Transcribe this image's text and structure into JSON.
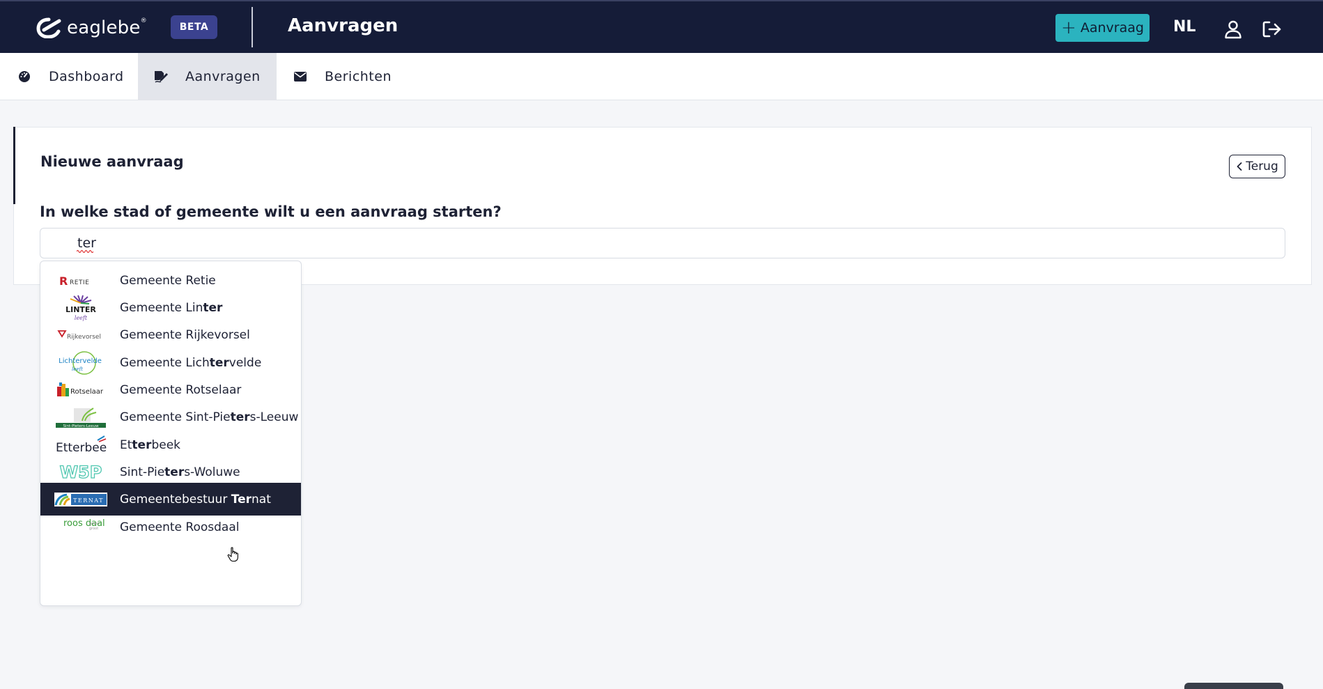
{
  "topbar": {
    "brand": "eaglebe",
    "brand_mark": "®",
    "badge": "BETA",
    "title": "Aanvragen",
    "new_button": "Aanvraag",
    "language": "NL"
  },
  "tabs": [
    {
      "label": "Dashboard",
      "icon": "dashboard-gauge-icon"
    },
    {
      "label": "Aanvragen",
      "icon": "edit-signature-icon",
      "active": true
    },
    {
      "label": "Berichten",
      "icon": "envelope-icon"
    }
  ],
  "card": {
    "title": "Nieuwe aanvraag",
    "back_button": "Terug",
    "question": "In welke stad of gemeente wilt u een aanvraag starten?",
    "search_value": "ter"
  },
  "dropdown": {
    "options": [
      {
        "pre": "Gemeente Retie",
        "hl": "",
        "post": "",
        "logo_text": "RETIE"
      },
      {
        "pre": "Gemeente Lin",
        "hl": "ter",
        "post": "",
        "logo_text": "LINTER"
      },
      {
        "pre": "Gemeente Rijkevorsel",
        "hl": "",
        "post": "",
        "logo_text": "Rijkevorsel"
      },
      {
        "pre": "Gemeente Lich",
        "hl": "ter",
        "post": "velde",
        "logo_text": "Lichtervelde"
      },
      {
        "pre": "Gemeente Rotselaar",
        "hl": "",
        "post": "",
        "logo_text": "Rotselaar"
      },
      {
        "pre": "Gemeente Sint-Pie",
        "hl": "ter",
        "post": "s-Leeuw",
        "logo_text": "Sint-Pieters-Leeuw"
      },
      {
        "pre": "Et",
        "hl": "ter",
        "post": "beek",
        "logo_text": "Etterbeek"
      },
      {
        "pre": "Sint-Pie",
        "hl": "ter",
        "post": "s-Woluwe",
        "logo_text": "W5P"
      },
      {
        "pre": "Gemeentebestuur ",
        "hl": "Ter",
        "post": "nat",
        "logo_text": "TERNAT",
        "active": true
      },
      {
        "pre": "Gemeente Roosdaal",
        "hl": "",
        "post": "",
        "logo_text": "roos daal"
      }
    ]
  },
  "colors": {
    "topbar_bg": "#151c38",
    "accent_teal": "#2bb3bf",
    "beta_badge": "#3b428f",
    "active_option": "#1e2235"
  }
}
